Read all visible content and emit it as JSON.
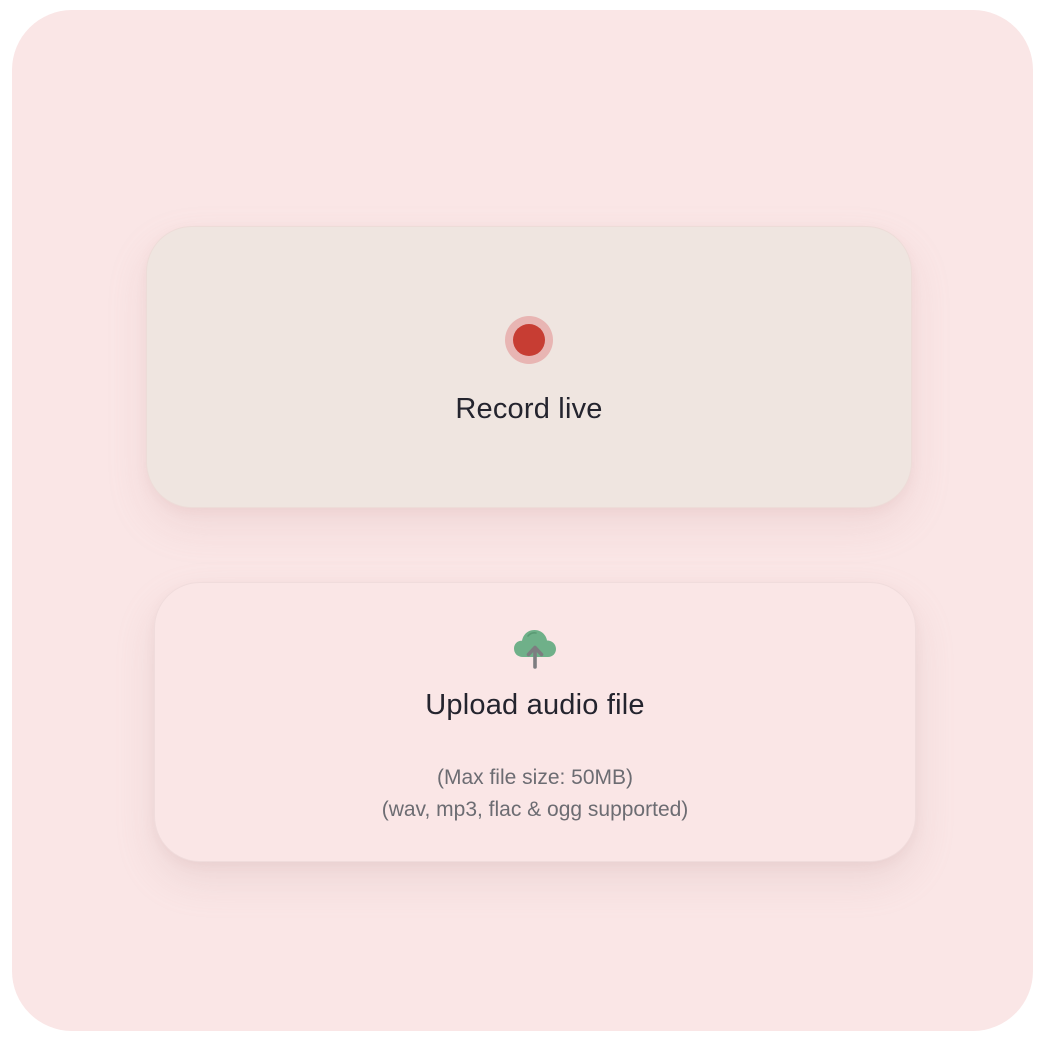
{
  "record": {
    "label": "Record live"
  },
  "upload": {
    "label": "Upload audio file",
    "max_size_note": "(Max file size: 50MB)",
    "formats_note": "(wav, mp3, flac & ogg supported)"
  },
  "icons": {
    "record": "record-dot-icon",
    "upload": "cloud-upload-icon"
  },
  "colors": {
    "background": "#fae6e6",
    "record_card_bg": "#efe5e0",
    "record_dot": "#c73d33",
    "record_ring": "#e8b5b3",
    "upload_icon": "#6fb089",
    "title_text": "#24242e",
    "note_text": "#6c6c72"
  }
}
